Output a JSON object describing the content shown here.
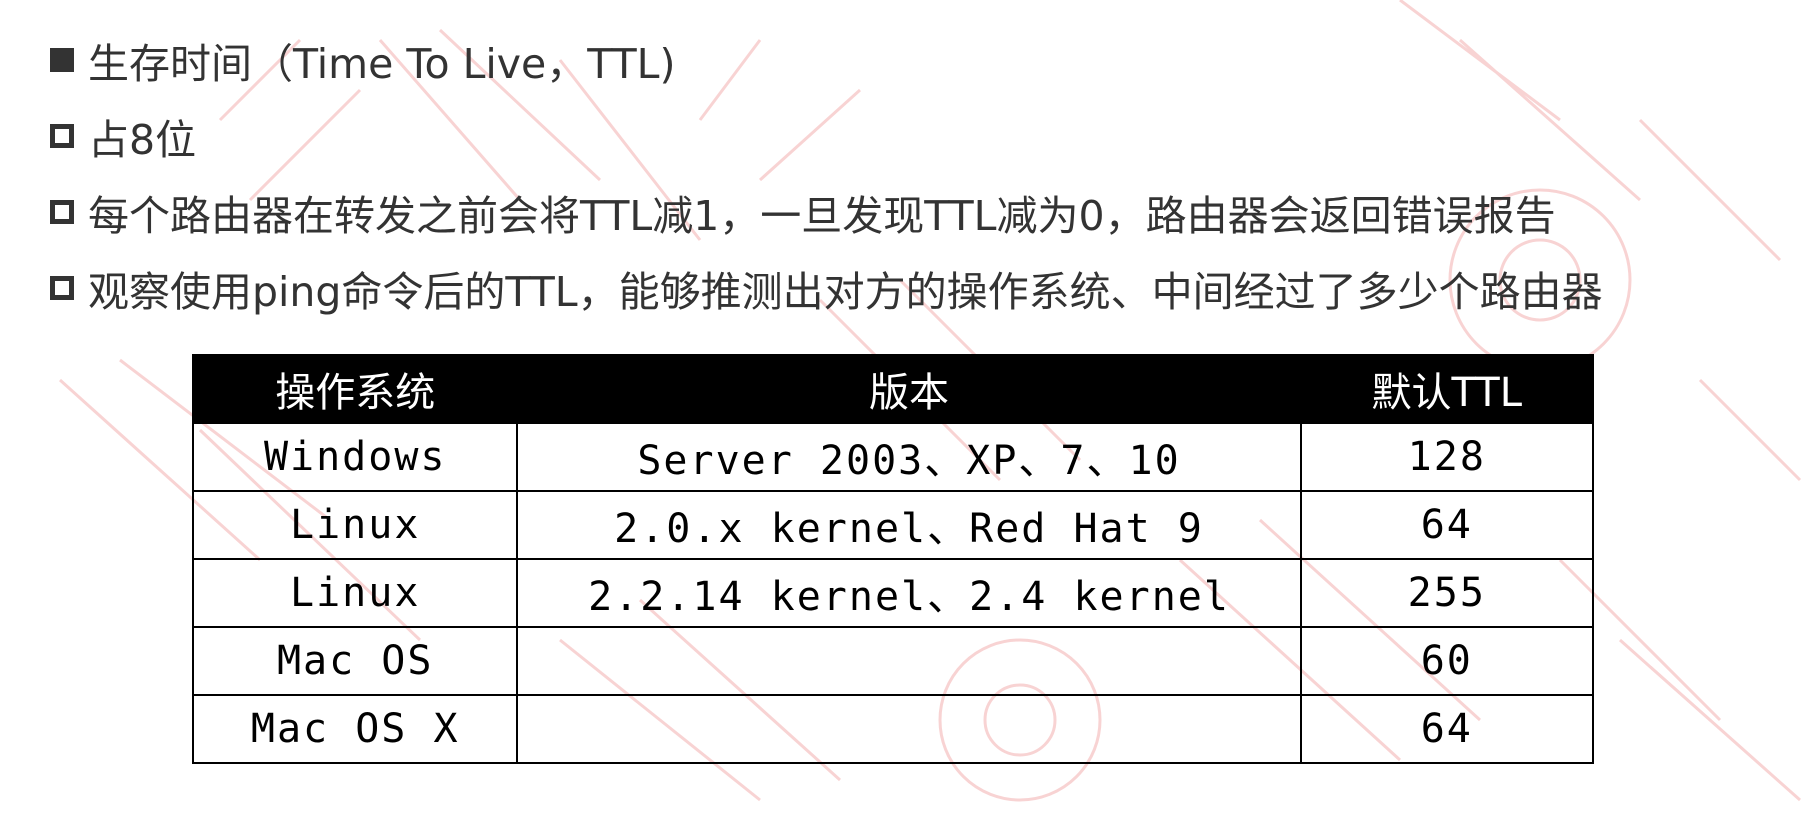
{
  "bullets": [
    {
      "marker": "filled-square",
      "text": "生存时间（Time To Live，TTL)"
    },
    {
      "marker": "hollow-square",
      "text": "占8位"
    },
    {
      "marker": "hollow-square",
      "text": "每个路由器在转发之前会将TTL减1，一旦发现TTL减为0，路由器会返回错误报告"
    },
    {
      "marker": "hollow-square",
      "text": "观察使用ping命令后的TTL，能够推测出对方的操作系统、中间经过了多少个路由器"
    }
  ],
  "table": {
    "headers": [
      "操作系统",
      "版本",
      "默认TTL"
    ],
    "rows": [
      [
        "Windows",
        "Server 2003、XP、7、10",
        "128"
      ],
      [
        "Linux",
        "2.0.x kernel、Red Hat 9",
        "64"
      ],
      [
        "Linux",
        "2.2.14 kernel、2.4 kernel",
        "255"
      ],
      [
        "Mac OS",
        "",
        "60"
      ],
      [
        "Mac OS X",
        "",
        "64"
      ]
    ]
  },
  "colors": {
    "text": "#333333",
    "header_bg": "#000000",
    "header_text": "#ffffff",
    "watermark": "#f4b6b6"
  }
}
